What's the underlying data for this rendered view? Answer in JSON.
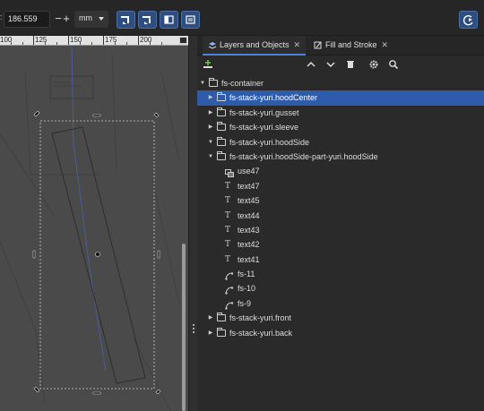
{
  "toolbar": {
    "colon": ":",
    "value": "186.559",
    "minus": "−",
    "plus": "+",
    "unit": "mm"
  },
  "ruler": {
    "labels": [
      "100",
      "125",
      "150",
      "175",
      "200"
    ]
  },
  "panel": {
    "tabs": [
      {
        "label": "Layers and Objects",
        "close": "✕"
      },
      {
        "label": "Fill and Stroke",
        "close": "✕"
      }
    ]
  },
  "tree": {
    "rows": [
      {
        "label": "fs-container",
        "arrow": "▼",
        "icon": "folder"
      },
      {
        "label": "fs-stack-yuri.hoodCenter",
        "arrow": "▶",
        "icon": "folder",
        "selected": true
      },
      {
        "label": "fs-stack-yuri.gusset",
        "arrow": "▶",
        "icon": "folder"
      },
      {
        "label": "fs-stack-yuri.sleeve",
        "arrow": "▶",
        "icon": "folder"
      },
      {
        "label": "fs-stack-yuri.hoodSide",
        "arrow": "▼",
        "icon": "folder"
      },
      {
        "label": "fs-stack-yuri.hoodSide-part-yuri.hoodSide",
        "arrow": "▼",
        "icon": "folder"
      },
      {
        "label": "use47",
        "icon": "clone"
      },
      {
        "label": "text47",
        "icon": "text"
      },
      {
        "label": "text45",
        "icon": "text"
      },
      {
        "label": "text44",
        "icon": "text"
      },
      {
        "label": "text43",
        "icon": "text"
      },
      {
        "label": "text42",
        "icon": "text"
      },
      {
        "label": "text41",
        "icon": "text"
      },
      {
        "label": "fs-11",
        "icon": "path"
      },
      {
        "label": "fs-10",
        "icon": "path"
      },
      {
        "label": "fs-9",
        "icon": "path"
      },
      {
        "label": "fs-stack-yuri.front",
        "arrow": "▶",
        "icon": "folder"
      },
      {
        "label": "fs-stack-yuri.back",
        "arrow": "▶",
        "icon": "folder"
      }
    ]
  },
  "colors": {
    "selection": "#2e5caa",
    "accent": "#4b82d6",
    "canvas": "#4a4a4a"
  }
}
